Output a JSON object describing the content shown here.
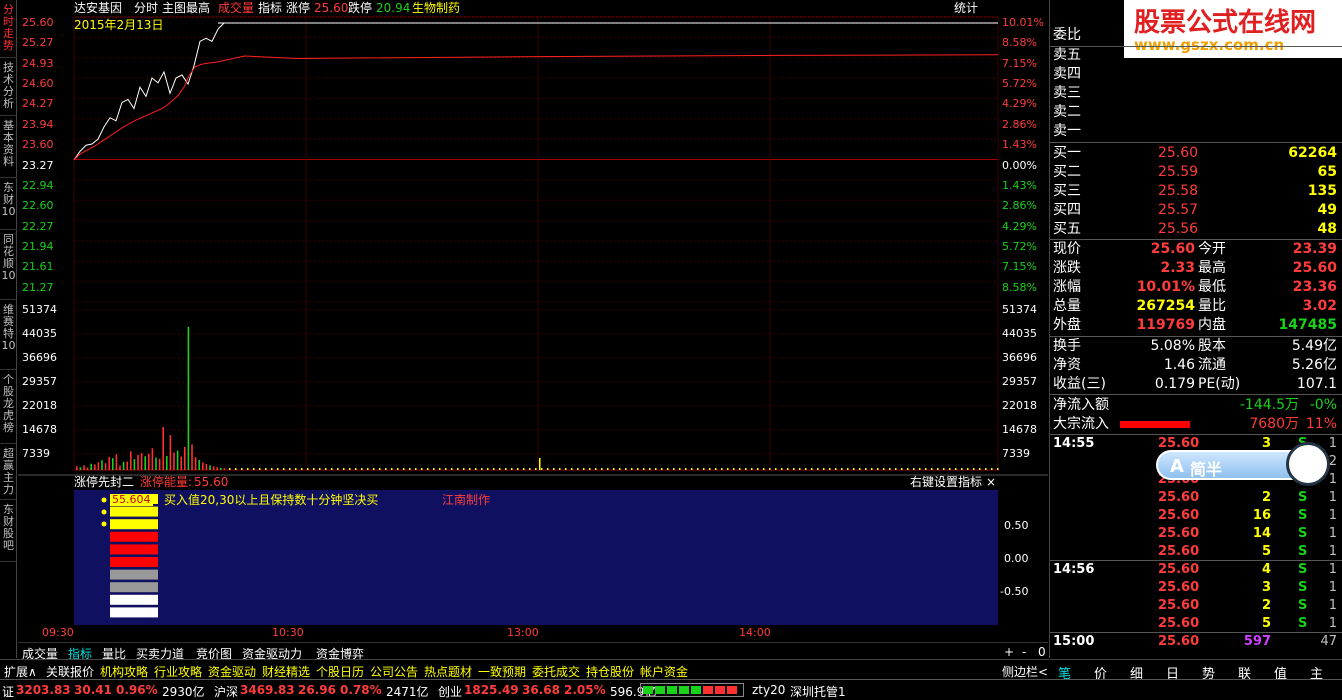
{
  "header": {
    "stock_name": "达安基因",
    "items": [
      "分时",
      "主图最高"
    ],
    "vol_label": "成交量",
    "indicator_label": "指标",
    "limit_up_label": "涨停",
    "limit_up_value": "25.60",
    "limit_down_label": "跌停",
    "limit_down_value": "20.94",
    "sector": "生物制药",
    "stats_label": "统计",
    "date": "2015年2月13日"
  },
  "left_tabs": [
    "分时走势",
    "技术分析",
    "基本资料",
    "东财10",
    "同花顺10",
    "维赛特10",
    "个股龙虎榜",
    "超赢主力",
    "东财股吧"
  ],
  "price_axis_left": [
    "25.60",
    "25.27",
    "24.93",
    "24.60",
    "24.27",
    "23.94",
    "23.60",
    "23.27",
    "22.94",
    "22.60",
    "22.27",
    "21.94",
    "21.61",
    "21.27"
  ],
  "price_axis_right": [
    "10.01%",
    "8.58%",
    "7.15%",
    "5.72%",
    "4.29%",
    "2.86%",
    "1.43%",
    "0.00%",
    "1.43%",
    "2.86%",
    "4.29%",
    "5.72%",
    "7.15%",
    "8.58%"
  ],
  "vol_axis": [
    "51374",
    "44035",
    "36696",
    "29357",
    "22018",
    "14678",
    "7339"
  ],
  "indicator_panel": {
    "title": "涨停先封二",
    "metric_label": "涨停能量:",
    "metric_value": "55.60",
    "right_label": "右键设置指标",
    "close": "×",
    "badge": "55.604",
    "note": "买入值20,30以上且保持数十分钟坚决买",
    "author": "江南制作",
    "axis": [
      "0.50",
      "0.00",
      "-0.50"
    ]
  },
  "time_axis": [
    "09:30",
    "10:30",
    "13:00",
    "14:00"
  ],
  "bottom_tabs": [
    "成交量",
    "指标",
    "量比",
    "买卖力道",
    "竞价图",
    "资金驱动力",
    "资金博弈"
  ],
  "zoom_plus": "+",
  "zoom_minus": "-",
  "zoom_zero": "0",
  "function_bar": [
    "扩展∧",
    "关联报价",
    "机构攻略",
    "行业攻略",
    "资金驱动",
    "财经精选",
    "个股日历",
    "公司公告",
    "热点题材",
    "一致预期",
    "委托成交",
    "持仓股份",
    "帐户资金"
  ],
  "sidebar_toggle": "侧边栏<",
  "right_tabs": [
    "笔",
    "价",
    "细",
    "日",
    "势",
    "联",
    "值",
    "主"
  ],
  "watermark": {
    "title": "股票公式在线网",
    "url": "www.gszx.com.cn"
  },
  "order_book": {
    "ratio_label": "委比",
    "sells": [
      "卖五",
      "卖四",
      "卖三",
      "卖二",
      "卖一"
    ],
    "buys": [
      {
        "label": "买一",
        "price": "25.60",
        "vol": "62264"
      },
      {
        "label": "买二",
        "price": "25.59",
        "vol": "65"
      },
      {
        "label": "买三",
        "price": "25.58",
        "vol": "135"
      },
      {
        "label": "买四",
        "price": "25.57",
        "vol": "49"
      },
      {
        "label": "买五",
        "price": "25.56",
        "vol": "48"
      }
    ]
  },
  "quote": [
    {
      "l": "现价",
      "lv": "25.60",
      "r": "今开",
      "rv": "23.39",
      "lc": "red",
      "rc": "red"
    },
    {
      "l": "涨跌",
      "lv": "2.33",
      "r": "最高",
      "rv": "25.60",
      "lc": "red",
      "rc": "red"
    },
    {
      "l": "涨幅",
      "lv": "10.01%",
      "r": "最低",
      "rv": "23.36",
      "lc": "red",
      "rc": "red"
    },
    {
      "l": "总量",
      "lv": "267254",
      "r": "量比",
      "rv": "3.02",
      "lc": "yellow",
      "rc": "red"
    },
    {
      "l": "外盘",
      "lv": "119769",
      "r": "内盘",
      "rv": "147485",
      "lc": "red",
      "rc": "green"
    }
  ],
  "fundamentals": [
    {
      "l": "换手",
      "lv": "5.08%",
      "r": "股本",
      "rv": "5.49亿"
    },
    {
      "l": "净资",
      "lv": "1.46",
      "r": "流通",
      "rv": "5.26亿"
    },
    {
      "l": "收益(三)",
      "lv": "0.179",
      "r": "PE(动)",
      "rv": "107.1"
    }
  ],
  "flows": {
    "net_label": "净流入额",
    "net_value": "-144.5万",
    "net_pct": "-0%",
    "block_label": "大宗流入",
    "block_value": "7680万",
    "block_pct": "11%"
  },
  "ticks": [
    {
      "t": "14:55",
      "p": "25.60",
      "v": "3",
      "s": "S",
      "n": "1",
      "vc": "yellow"
    },
    {
      "t": "",
      "p": "25.60",
      "v": "",
      "s": "",
      "n": "2",
      "vc": "yellow"
    },
    {
      "t": "",
      "p": "25.60",
      "v": "",
      "s": "",
      "n": "1",
      "vc": "yellow"
    },
    {
      "t": "",
      "p": "25.60",
      "v": "2",
      "s": "S",
      "n": "1",
      "vc": "yellow"
    },
    {
      "t": "",
      "p": "25.60",
      "v": "16",
      "s": "S",
      "n": "1",
      "vc": "yellow"
    },
    {
      "t": "",
      "p": "25.60",
      "v": "14",
      "s": "S",
      "n": "1",
      "vc": "yellow"
    },
    {
      "t": "",
      "p": "25.60",
      "v": "5",
      "s": "S",
      "n": "1",
      "vc": "yellow"
    },
    {
      "t": "14:56",
      "p": "25.60",
      "v": "4",
      "s": "S",
      "n": "1",
      "vc": "yellow"
    },
    {
      "t": "",
      "p": "25.60",
      "v": "3",
      "s": "S",
      "n": "1",
      "vc": "yellow"
    },
    {
      "t": "",
      "p": "25.60",
      "v": "2",
      "s": "S",
      "n": "1",
      "vc": "yellow"
    },
    {
      "t": "",
      "p": "25.60",
      "v": "5",
      "s": "S",
      "n": "1",
      "vc": "yellow"
    },
    {
      "t": "15:00",
      "p": "25.60",
      "v": "597",
      "s": "",
      "n": "47",
      "vc": "purple"
    }
  ],
  "status_bar": [
    {
      "k": "证",
      "v": "3203.83",
      "c": "30.41",
      "p": "0.96%",
      "a": "2930亿"
    },
    {
      "k": "沪深",
      "v": "3469.83",
      "c": "26.96",
      "p": "0.78%",
      "a": "2471亿"
    },
    {
      "k": "创业",
      "v": "1825.49",
      "c": "36.68",
      "p": "2.05%",
      "a": "596.9亿"
    }
  ],
  "status_right": [
    "zty20",
    "深圳托管1"
  ],
  "ime_label": "简半",
  "series": {
    "price_line": [
      23.36,
      23.5,
      23.6,
      23.62,
      23.7,
      23.9,
      24.05,
      24.0,
      24.3,
      24.35,
      24.2,
      24.55,
      24.4,
      24.7,
      24.62,
      24.8,
      24.45,
      24.7,
      24.75,
      24.6,
      24.9,
      25.3,
      25.35,
      25.3,
      25.5,
      25.6,
      25.6
    ],
    "avg_line": [
      23.36,
      23.45,
      23.5,
      23.55,
      23.6,
      23.66,
      23.72,
      23.78,
      23.84,
      23.9,
      23.95,
      24.0,
      24.04,
      24.08,
      24.12,
      24.16,
      24.2,
      24.26,
      24.34,
      24.42,
      24.55,
      24.75,
      24.88,
      24.92,
      24.94,
      24.95,
      24.96,
      24.98,
      25.0,
      25.02,
      25.04,
      25.06
    ]
  },
  "volume_bars": [
    1200,
    900,
    1500,
    800,
    2000,
    1800,
    2500,
    3100,
    2200,
    4200,
    3800,
    5000,
    1400,
    2600,
    2700,
    6000,
    3500,
    4800,
    5400,
    4400,
    5200,
    7000,
    4000,
    3600,
    13800,
    4500,
    11200,
    5600,
    6200,
    4300,
    7400,
    46000,
    8200,
    4100,
    3200,
    2400,
    1900,
    1500,
    1200,
    900,
    700,
    600
  ]
}
